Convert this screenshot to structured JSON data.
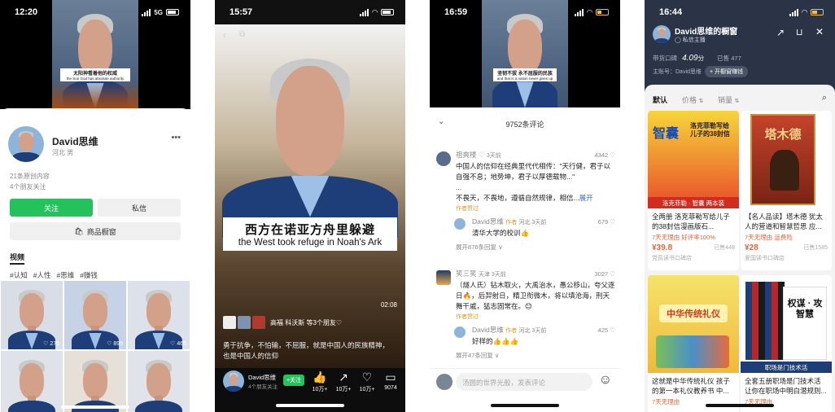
{
  "p1": {
    "time": "12:20",
    "signal": "5G",
    "subtitle_cn": "太阳神看着他的权威",
    "subtitle_en": "the Sun God has absolute authority",
    "name": "David思维",
    "location": "河北 男",
    "more": "•••",
    "stats": "21条原创内容",
    "friends": "4个朋友关注",
    "follow": "关注",
    "message": "私信",
    "shop": "商品橱窗",
    "tab": "视频",
    "tags": [
      "#认知",
      "#人性",
      "#思维",
      "#赚钱"
    ],
    "thumbs": [
      "276",
      "895",
      "465",
      "",
      "",
      ""
    ]
  },
  "p2": {
    "time": "15:57",
    "cap_cn": "西方在诺亚方舟里躲避",
    "cap_en": "the West took refuge in Noah's Ark",
    "duration": "02:08",
    "friends": "高福 科沃斯 等3个朋友♡",
    "desc1": "勇于抗争，不怕输，不屈服，就是中国人的民族精神，",
    "desc2": "也是中国人的信仰",
    "author": "David思维",
    "author_sub": "4个朋友关注",
    "follow": "+关注",
    "actions": [
      {
        "icon": "thumb-up-icon",
        "glyph": "👍",
        "label": "10万+"
      },
      {
        "icon": "share-icon",
        "glyph": "↗",
        "label": "10万+"
      },
      {
        "icon": "heart-icon",
        "glyph": "♡",
        "label": "10万+"
      },
      {
        "icon": "comment-icon",
        "glyph": "▭",
        "label": "9074"
      }
    ]
  },
  "p3": {
    "time": "16:59",
    "subtitle_cn": "坚韧不拔 永不屈服的民族",
    "subtitle_en": "and that is a nation never gives up",
    "count": "9752条评论",
    "comments": [
      {
        "user": "祖爽楼",
        "badge": "♡",
        "meta": "3天前",
        "likes": "4342 ♡",
        "text": "中国人的信仰在经典里代代相传：\"天行健，君子以自强不息；地势坤，君子以厚德载物...\"",
        "more": "...",
        "text2": "不畏天，不畏地，遵循自然规律，相信...",
        "expand": "展开",
        "author_like": "作者赞过"
      },
      {
        "user": "David思维",
        "role": "作者",
        "meta": "河北 3天前",
        "likes": "679 ♡",
        "text": "清华大学的校训👍",
        "replies": "展开876条回复 ∨"
      },
      {
        "user": "笑三笑",
        "meta": "天津 3天前",
        "likes": "3027 ♡",
        "text": "（燧人氏）钻木取火，大禹治水，愚公移山，夸父逐日🔥，后羿射日，精卫衔微木，将以填沧海，刑天舞干戚，猛志固常在。😊",
        "author_like": "作者赞过"
      },
      {
        "user": "David思维",
        "role": "作者",
        "meta": "河北 3天前",
        "likes": "425 ♡",
        "text": "好样的👍👍👍",
        "replies": "展开47条回复 ∨"
      }
    ],
    "input_placeholder": "汤圆的世界光般，发表评论",
    "emoji": "☺"
  },
  "p4": {
    "time": "16:44",
    "title": "David思维的橱窗",
    "sub": "◯ 私信主播",
    "score_label": "带货口碑",
    "score": "4.09",
    "score_unit": "分",
    "sold": "已售 477",
    "shop_owner": "主账号：David思维",
    "open_btn": "+ 开橱窗赚钱",
    "tabs": [
      "默认",
      "价格",
      "销量"
    ],
    "products": [
      {
        "title": "全两册 洛克菲勒写给儿子的38封信漫画版石...",
        "sub": "7天无理由  好评率100%",
        "price": "¥39.8",
        "sold": "已售448",
        "shop": "党员读书口碑店"
      },
      {
        "title": "【名人品读】塔木德 犹太人的营道和智慧哲思 应...",
        "sub": "7天无理由  运费险",
        "price": "¥28",
        "sold": "已售1585",
        "shop": "爱国读书口碑店"
      },
      {
        "title": "这就是中华传统礼仪 孩子的第一本礼仪教养书 中...",
        "sub": "7天无理由",
        "price": "",
        "sold": "",
        "shop": ""
      },
      {
        "title": "全套五册职场是门技术活 让你在职场中明白潜规则...",
        "sub": "7天无理由",
        "price": "",
        "sold": "",
        "shop": ""
      }
    ],
    "book1": "智囊",
    "book1_sub": "洛克菲勒写给儿子的38封信",
    "book1_band": "洛克菲勒 · 智囊 两本装",
    "book2": "塔木德",
    "book3": "中华传统礼仪",
    "book4": "权谋 · 攻智慧",
    "book4_band": "职场是门技术活",
    "colors": {
      "green": "#24c25c",
      "orange": "#e0663c",
      "navy": "#2b3446"
    }
  }
}
